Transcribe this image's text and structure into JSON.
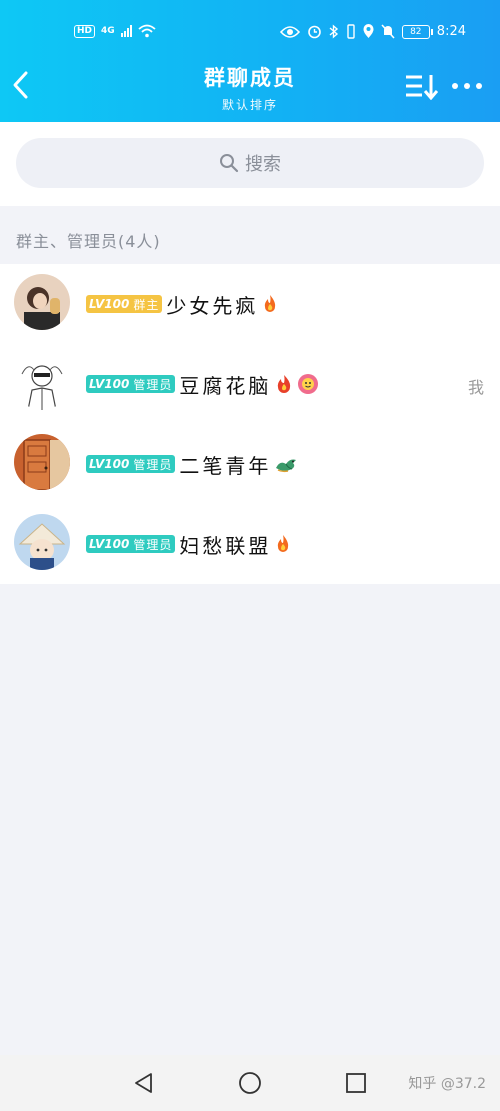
{
  "status_bar": {
    "hd": "HD",
    "network": "4G",
    "battery": "82",
    "time": "8:24"
  },
  "header": {
    "title": "群聊成员",
    "subtitle": "默认排序"
  },
  "search": {
    "label": "搜索"
  },
  "section": {
    "label": "群主、管理员(4人)"
  },
  "members": [
    {
      "level": "LV100",
      "role": "群主",
      "name": "少女先疯",
      "role_type": "owner",
      "avatar_icon": "avatar-photo-icon"
    },
    {
      "level": "LV100",
      "role": "管理员",
      "name": "豆腐花脑",
      "role_type": "admin",
      "me": "我",
      "avatar_icon": "avatar-sketch-icon"
    },
    {
      "level": "LV100",
      "role": "管理员",
      "name": "二笔青年",
      "role_type": "admin",
      "avatar_icon": "avatar-door-icon"
    },
    {
      "level": "LV100",
      "role": "管理员",
      "name": "妇愁联盟",
      "role_type": "admin",
      "avatar_icon": "avatar-anime-icon"
    }
  ],
  "nav": {
    "watermark": "知乎 @37.2"
  },
  "colors": {
    "header_start": "#0ec8f5",
    "header_end": "#1a9ef3",
    "owner_badge": "#f5c443",
    "admin_badge": "#2fcbc0"
  }
}
